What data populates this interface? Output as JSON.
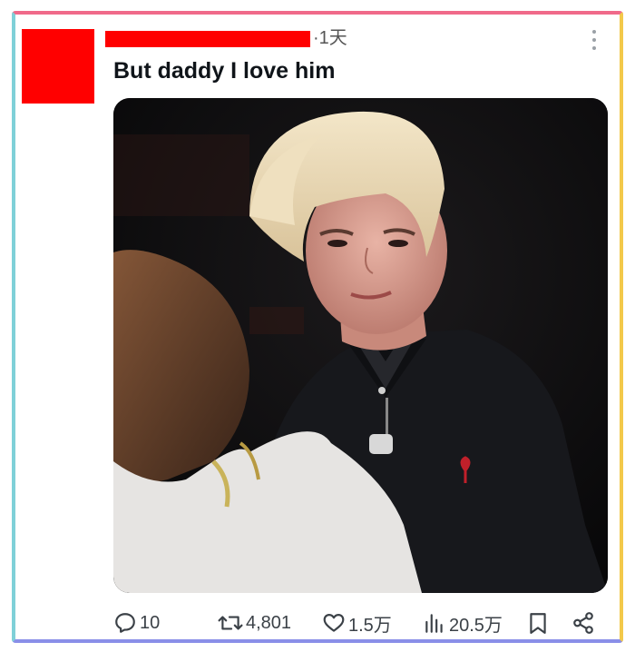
{
  "post": {
    "time_separator": "·",
    "time": "1天",
    "text": "But daddy I love him"
  },
  "actions": {
    "replies": "10",
    "reposts": "4,801",
    "likes": "1.5万",
    "views": "20.5万"
  },
  "icons": {
    "reply": "comment-icon",
    "repost": "retweet-icon",
    "like": "heart-icon",
    "views": "bar-chart-icon",
    "bookmark": "bookmark-icon",
    "share": "share-icon",
    "more": "more-vertical-icon"
  },
  "colors": {
    "redaction": "#ff0000",
    "frame_top": "#f06a8a",
    "frame_left": "#7fd0d8",
    "frame_right": "#f3c94a",
    "frame_bottom": "#8a8fe8"
  }
}
